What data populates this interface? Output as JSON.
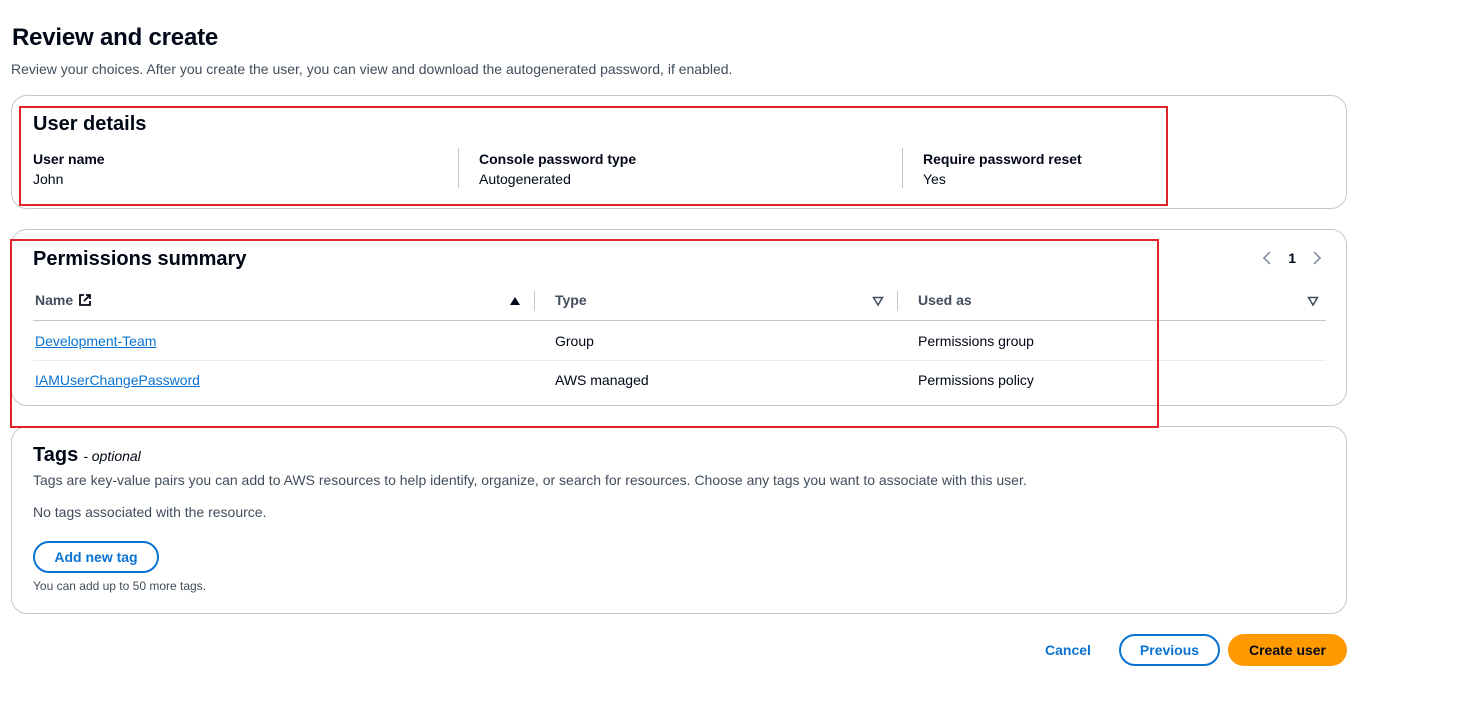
{
  "page": {
    "title": "Review and create",
    "description": "Review your choices. After you create the user, you can view and download the autogenerated password, if enabled."
  },
  "user_details": {
    "header": "User details",
    "fields": [
      {
        "label": "User name",
        "value": "John"
      },
      {
        "label": "Console password type",
        "value": "Autogenerated"
      },
      {
        "label": "Require password reset",
        "value": "Yes"
      }
    ]
  },
  "permissions": {
    "header": "Permissions summary",
    "page_number": "1",
    "columns": [
      {
        "label": "Name",
        "sort": "ascending"
      },
      {
        "label": "Type",
        "sort": "none"
      },
      {
        "label": "Used as",
        "sort": "none"
      }
    ],
    "rows": [
      {
        "name": "Development-Team",
        "type": "Group",
        "used_as": "Permissions group"
      },
      {
        "name": "IAMUserChangePassword",
        "type": "AWS managed",
        "used_as": "Permissions policy"
      }
    ]
  },
  "tags": {
    "title": "Tags",
    "optional": "- optional",
    "description": "Tags are key-value pairs you can add to AWS resources to help identify, organize, or search for resources. Choose any tags you want to associate with this user.",
    "empty_text": "No tags associated with the resource.",
    "add_button": "Add new tag",
    "hint": "You can add up to 50 more tags."
  },
  "footer": {
    "cancel": "Cancel",
    "previous": "Previous",
    "create": "Create user"
  },
  "colors": {
    "link": "#0972d3",
    "primary": "#ff9900",
    "highlight": "#e0242b",
    "border": "#c6c6cd"
  }
}
